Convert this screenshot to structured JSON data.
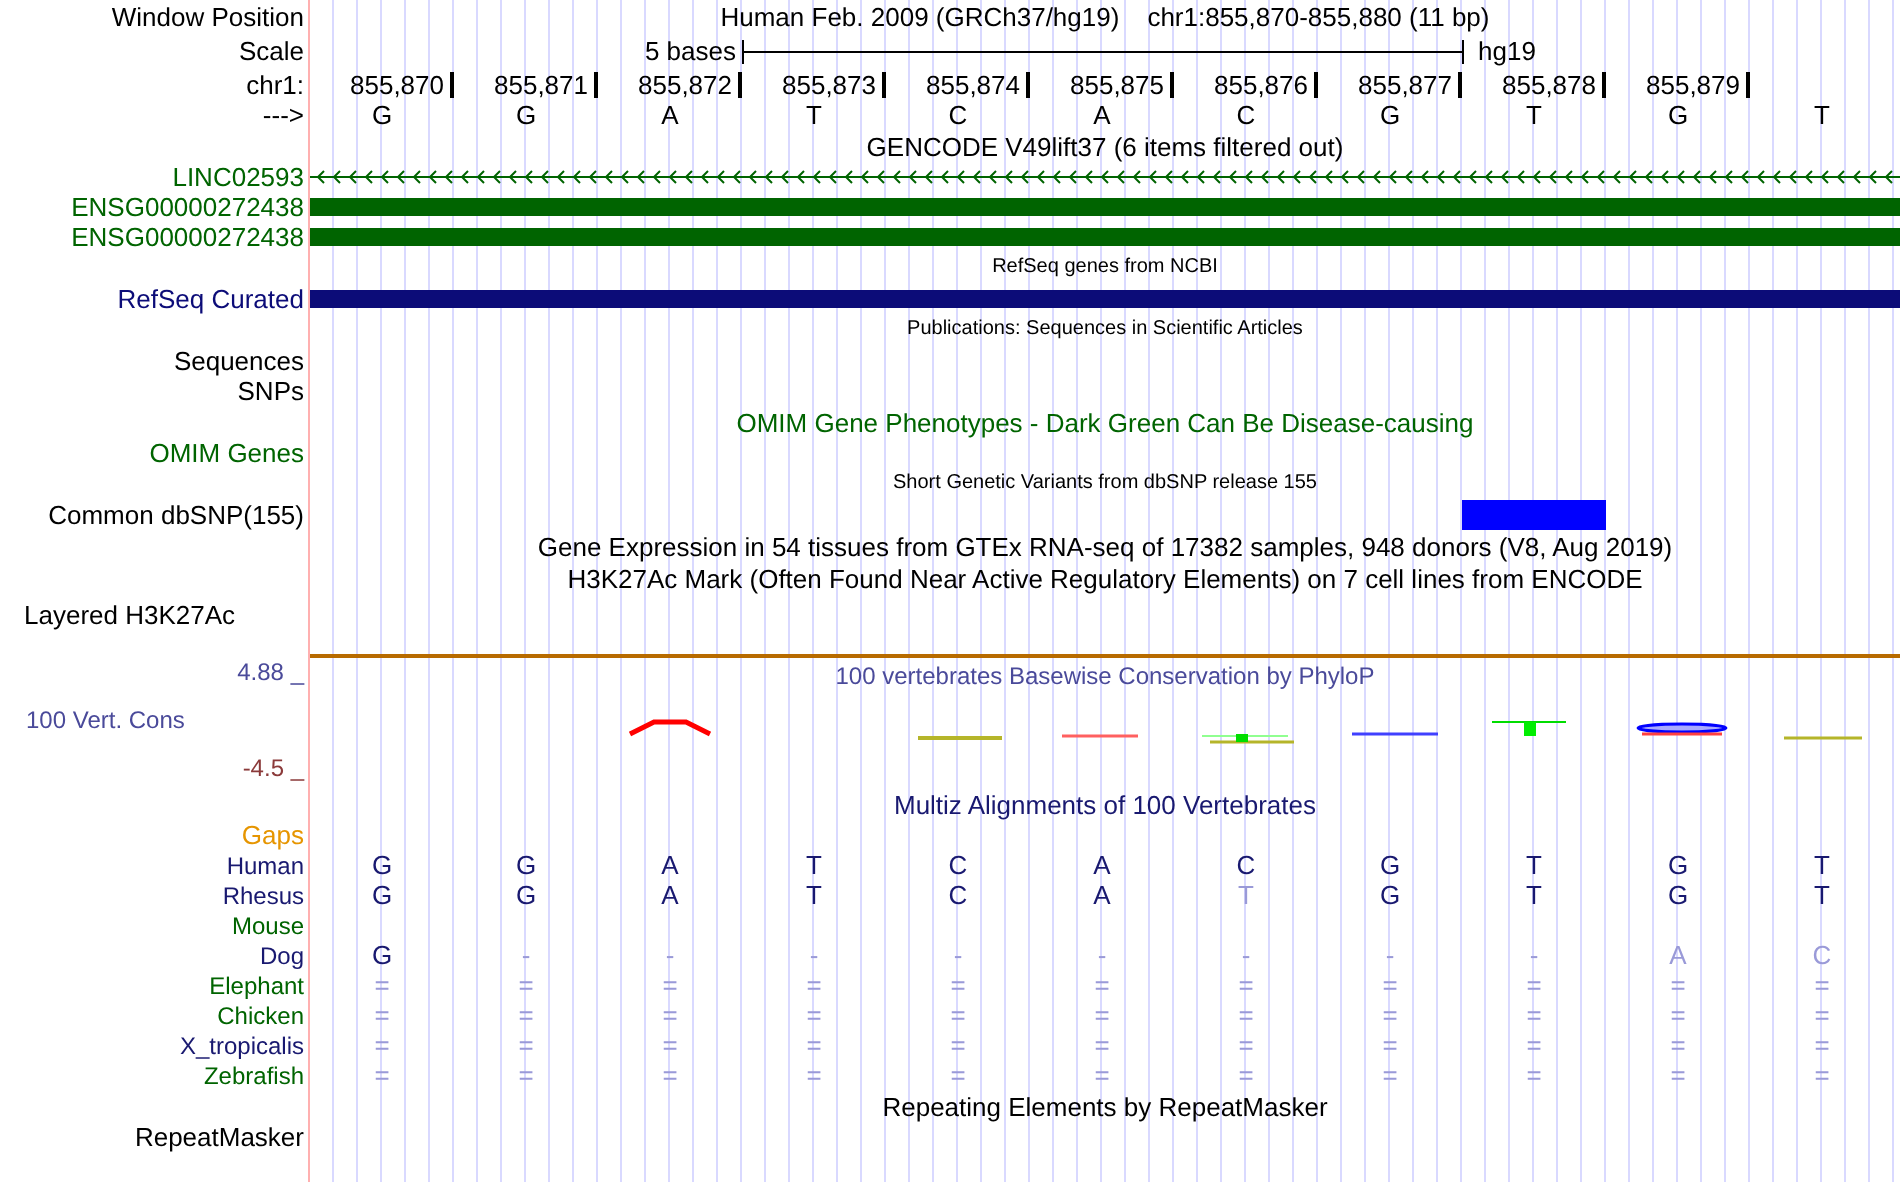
{
  "header": {
    "label": "Window Position",
    "assembly": "Human Feb. 2009 (GRCh37/hg19)",
    "position": "chr1:855,870-855,880 (11 bp)"
  },
  "scale": {
    "label": "Scale",
    "span": "5 bases",
    "database": "hg19"
  },
  "ruler": {
    "label": "chr1:",
    "positions": [
      "855,870",
      "855,871",
      "855,872",
      "855,873",
      "855,874",
      "855,875",
      "855,876",
      "855,877",
      "855,878",
      "855,879"
    ]
  },
  "sequence": {
    "label": "--->",
    "bases": [
      "G",
      "G",
      "A",
      "T",
      "C",
      "A",
      "C",
      "G",
      "T",
      "G",
      "T"
    ]
  },
  "rows": [
    {
      "kind": "title",
      "text": "GENCODE V49lift37 (6 items filtered out)"
    },
    {
      "kind": "intron",
      "label": "LINC02593",
      "color": "#006400"
    },
    {
      "kind": "exon",
      "label": "ENSG00000272438",
      "color": "#006400"
    },
    {
      "kind": "exon",
      "label": "ENSG00000272438",
      "color": "#006400"
    },
    {
      "kind": "caption",
      "text": "RefSeq genes from NCBI"
    },
    {
      "kind": "exon",
      "label": "RefSeq Curated",
      "color": "#0c0c78"
    },
    {
      "kind": "caption",
      "text": "Publications: Sequences in Scientific Articles"
    },
    {
      "kind": "label",
      "label": "Sequences"
    },
    {
      "kind": "label",
      "label": "SNPs"
    },
    {
      "kind": "title",
      "text": "OMIM Gene Phenotypes - Dark Green Can Be Disease-causing",
      "color": "#006400"
    },
    {
      "kind": "label",
      "label": "OMIM Genes",
      "color": "#006400"
    },
    {
      "kind": "caption",
      "text": "Short Genetic Variants from dbSNP release 155"
    },
    {
      "kind": "variant",
      "label": "Common dbSNP(155)",
      "features": [
        false,
        false,
        false,
        false,
        false,
        false,
        false,
        false,
        true,
        false,
        false
      ]
    },
    {
      "kind": "title",
      "text": "Gene Expression in 54 tissues from GTEx RNA-seq of 17382 samples, 948 donors (V8, Aug 2019)"
    },
    {
      "kind": "title",
      "text": "H3K27Ac Mark (Often Found Near Active Regulatory Elements) on 7 cell lines from ENCODE"
    },
    {
      "kind": "signal",
      "label": "Layered H3K27Ac"
    },
    {
      "kind": "conservation",
      "scale_max": "4.88 _",
      "label": "100 Vert. Cons",
      "scale_min": "-4.5 _",
      "title": "100 vertebrates Basewise Conservation by PhyloP"
    },
    {
      "kind": "title",
      "text": "Multiz Alignments of 100 Vertebrates",
      "color": "#191970"
    },
    {
      "kind": "label",
      "label": "Gaps",
      "color": "#e69500"
    },
    {
      "kind": "alignment",
      "label": "Human",
      "color": "#191970",
      "bases": [
        {
          "text": "G",
          "faded": false
        },
        {
          "text": "G",
          "faded": false
        },
        {
          "text": "A",
          "faded": false
        },
        {
          "text": "T",
          "faded": false
        },
        {
          "text": "C",
          "faded": false
        },
        {
          "text": "A",
          "faded": false
        },
        {
          "text": "C",
          "faded": false
        },
        {
          "text": "G",
          "faded": false
        },
        {
          "text": "T",
          "faded": false
        },
        {
          "text": "G",
          "faded": false
        },
        {
          "text": "T",
          "faded": false
        }
      ]
    },
    {
      "kind": "alignment",
      "label": "Rhesus",
      "color": "#191970",
      "bases": [
        {
          "text": "G",
          "faded": false
        },
        {
          "text": "G",
          "faded": false
        },
        {
          "text": "A",
          "faded": false
        },
        {
          "text": "T",
          "faded": false
        },
        {
          "text": "C",
          "faded": false
        },
        {
          "text": "A",
          "faded": false
        },
        {
          "text": "T",
          "faded": true
        },
        {
          "text": "G",
          "faded": false
        },
        {
          "text": "T",
          "faded": false
        },
        {
          "text": "G",
          "faded": false
        },
        {
          "text": "T",
          "faded": false
        }
      ]
    },
    {
      "kind": "alignment",
      "label": "Mouse",
      "color": "#006400"
    },
    {
      "kind": "alignment",
      "label": "Dog",
      "color": "#191970",
      "bases": [
        {
          "text": "G",
          "faded": false
        },
        {
          "text": "-",
          "faded": true
        },
        {
          "text": "-",
          "faded": true
        },
        {
          "text": "-",
          "faded": true
        },
        {
          "text": "-",
          "faded": true
        },
        {
          "text": "-",
          "faded": true
        },
        {
          "text": "-",
          "faded": true
        },
        {
          "text": "-",
          "faded": true
        },
        {
          "text": "-",
          "faded": true
        },
        {
          "text": "A",
          "faded": true
        },
        {
          "text": "C",
          "faded": true
        }
      ]
    },
    {
      "kind": "alignment",
      "label": "Elephant",
      "color": "#006400",
      "bases": [
        {
          "text": "=",
          "faded": true
        },
        {
          "text": "=",
          "faded": true
        },
        {
          "text": "=",
          "faded": true
        },
        {
          "text": "=",
          "faded": true
        },
        {
          "text": "=",
          "faded": true
        },
        {
          "text": "=",
          "faded": true
        },
        {
          "text": "=",
          "faded": true
        },
        {
          "text": "=",
          "faded": true
        },
        {
          "text": "=",
          "faded": true
        },
        {
          "text": "=",
          "faded": true
        },
        {
          "text": "=",
          "faded": true
        }
      ]
    },
    {
      "kind": "alignment",
      "label": "Chicken",
      "color": "#006400",
      "bases": [
        {
          "text": "=",
          "faded": true
        },
        {
          "text": "=",
          "faded": true
        },
        {
          "text": "=",
          "faded": true
        },
        {
          "text": "=",
          "faded": true
        },
        {
          "text": "=",
          "faded": true
        },
        {
          "text": "=",
          "faded": true
        },
        {
          "text": "=",
          "faded": true
        },
        {
          "text": "=",
          "faded": true
        },
        {
          "text": "=",
          "faded": true
        },
        {
          "text": "=",
          "faded": true
        },
        {
          "text": "=",
          "faded": true
        }
      ]
    },
    {
      "kind": "alignment",
      "label": "X_tropicalis",
      "color": "#191970",
      "bases": [
        {
          "text": "=",
          "faded": true
        },
        {
          "text": "=",
          "faded": true
        },
        {
          "text": "=",
          "faded": true
        },
        {
          "text": "=",
          "faded": true
        },
        {
          "text": "=",
          "faded": true
        },
        {
          "text": "=",
          "faded": true
        },
        {
          "text": "=",
          "faded": true
        },
        {
          "text": "=",
          "faded": true
        },
        {
          "text": "=",
          "faded": true
        },
        {
          "text": "=",
          "faded": true
        },
        {
          "text": "=",
          "faded": true
        }
      ]
    },
    {
      "kind": "alignment",
      "label": "Zebrafish",
      "color": "#006400",
      "bases": [
        {
          "text": "=",
          "faded": true
        },
        {
          "text": "=",
          "faded": true
        },
        {
          "text": "=",
          "faded": true
        },
        {
          "text": "=",
          "faded": true
        },
        {
          "text": "=",
          "faded": true
        },
        {
          "text": "=",
          "faded": true
        },
        {
          "text": "=",
          "faded": true
        },
        {
          "text": "=",
          "faded": true
        },
        {
          "text": "=",
          "faded": true
        },
        {
          "text": "=",
          "faded": true
        },
        {
          "text": "=",
          "faded": true
        }
      ]
    },
    {
      "kind": "title",
      "text": "Repeating Elements by RepeatMasker"
    },
    {
      "kind": "label",
      "label": "RepeatMasker"
    }
  ]
}
